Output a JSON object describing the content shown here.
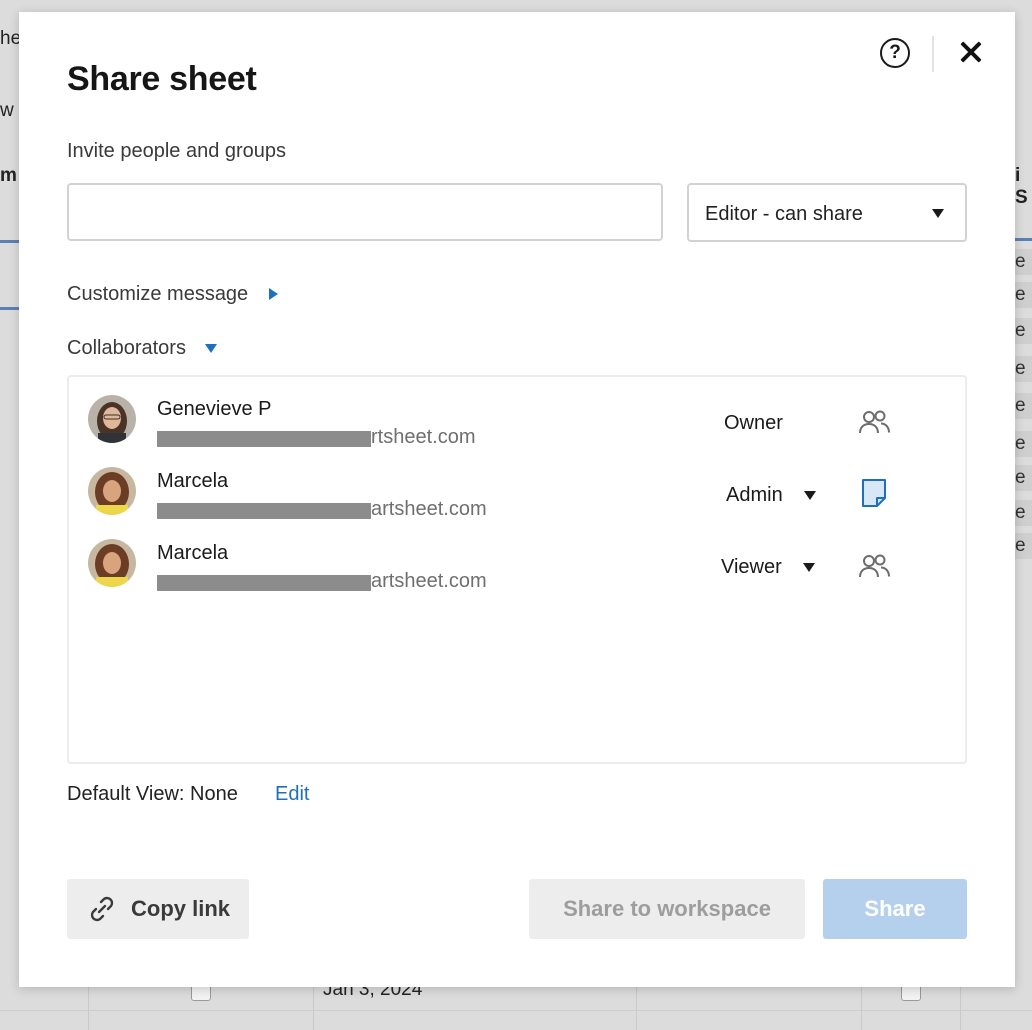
{
  "background": {
    "left_fragments": [
      "he",
      "w",
      "m"
    ],
    "right_fragment": "i S",
    "right_cells": [
      "e",
      "e",
      "e",
      "e",
      "e",
      "e",
      "e",
      "e",
      "e"
    ],
    "date_cell": "Jan 3, 2024"
  },
  "dialog": {
    "title": "Share sheet",
    "help_glyph": "?",
    "invite": {
      "label": "Invite people and groups",
      "input_value": "",
      "permission": "Editor - can share"
    },
    "customize_message": "Customize message",
    "collaborators_label": "Collaborators",
    "collaborators": [
      {
        "name": "Genevieve P",
        "email_visible": "rtsheet.com",
        "role": "Owner",
        "type_icon": "group-icon"
      },
      {
        "name": "Marcela",
        "email_visible": "artsheet.com",
        "role": "Admin",
        "type_icon": "sheet-icon"
      },
      {
        "name": "Marcela",
        "email_visible": "artsheet.com",
        "role": "Viewer",
        "type_icon": "group-icon"
      }
    ],
    "default_view": "Default View: None",
    "edit_link": "Edit",
    "buttons": {
      "copy_link": "Copy link",
      "share_to_workspace": "Share to workspace",
      "share": "Share"
    }
  },
  "colors": {
    "accent": "#1f6fc1",
    "share_disabled_bg": "#b5d0ec",
    "secondary_btn_bg": "#ededed"
  }
}
